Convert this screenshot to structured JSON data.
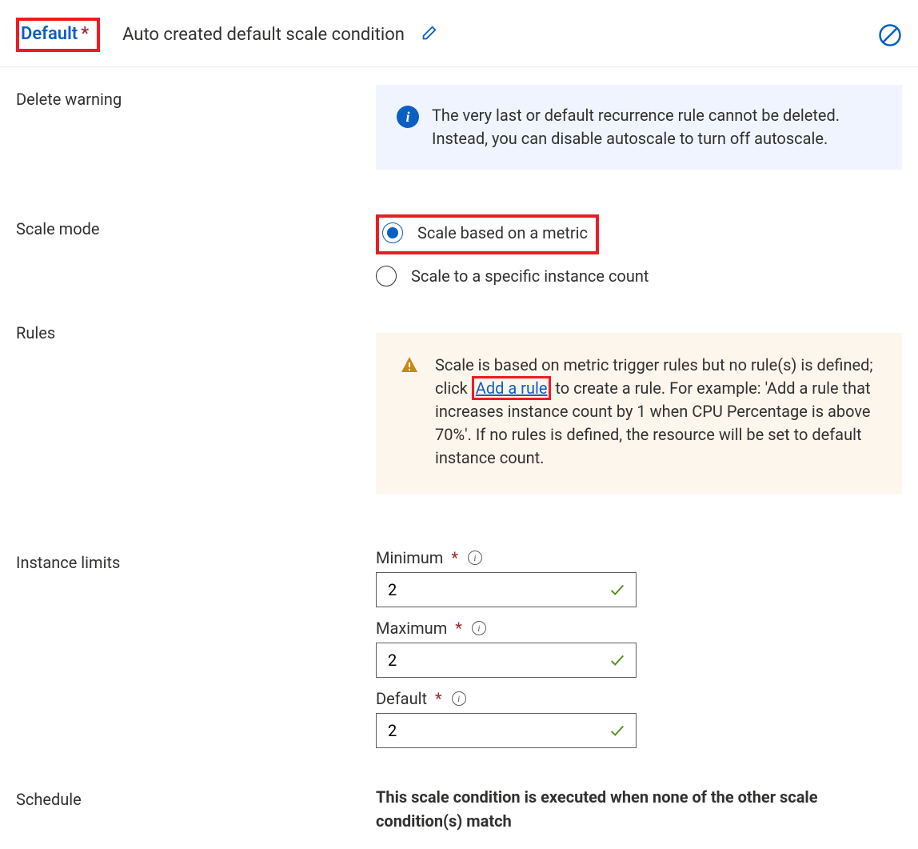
{
  "header": {
    "title": "Default",
    "subtitle": "Auto created default scale condition"
  },
  "sections": {
    "deleteWarning": {
      "label": "Delete warning",
      "message": "The very last or default recurrence rule cannot be deleted. Instead, you can disable autoscale to turn off autoscale."
    },
    "scaleMode": {
      "label": "Scale mode",
      "options": {
        "metric": "Scale based on a metric",
        "count": "Scale to a specific instance count"
      }
    },
    "rules": {
      "label": "Rules",
      "warning_prefix": "Scale is based on metric trigger rules but no rule(s) is defined; click ",
      "warning_link": "Add a rule",
      "warning_suffix": " to create a rule. For example: 'Add a rule that increases instance count by 1 when CPU Percentage is above 70%'. If no rules is defined, the resource will be set to default instance count."
    },
    "instanceLimits": {
      "label": "Instance limits",
      "minimum_label": "Minimum",
      "minimum_value": "2",
      "maximum_label": "Maximum",
      "maximum_value": "2",
      "default_label": "Default",
      "default_value": "2"
    },
    "schedule": {
      "label": "Schedule",
      "text": "This scale condition is executed when none of the other scale condition(s) match"
    }
  }
}
